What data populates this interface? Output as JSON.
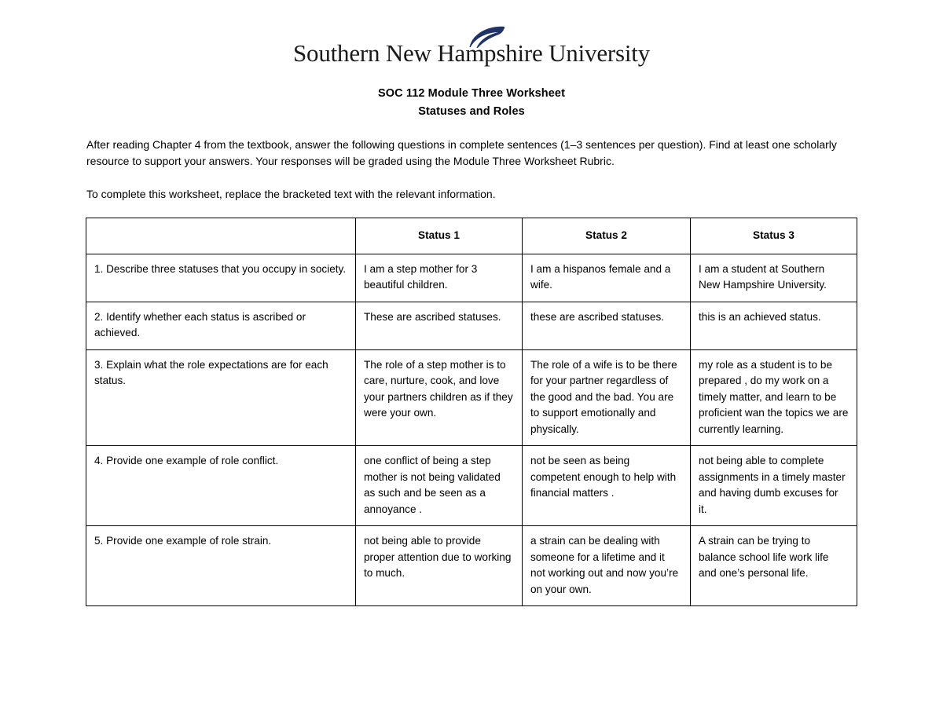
{
  "logo": {
    "text": "Southern New Hampshire University",
    "quill_color": "#1F3366",
    "icon": "feather-quill-icon"
  },
  "header": {
    "title": "SOC 112 Module Three Worksheet",
    "subtitle": "Statuses and Roles"
  },
  "intro": {
    "paragraph_1": "After reading Chapter 4 from the textbook, answer the following questions in complete sentences (1–3 sentences per question). Find at least one scholarly resource to support your answers. Your responses will be graded using the Module Three Worksheet Rubric.",
    "paragraph_2": "To complete this worksheet, replace the bracketed text with the relevant information."
  },
  "table": {
    "headers": [
      "",
      "Status 1",
      "Status 2",
      "Status 3"
    ],
    "rows": [
      {
        "question": "1. Describe three statuses that you occupy in society.",
        "status_1": "I am a step mother for 3 beautiful children.",
        "status_2": "I am a hispanos female and a wife.",
        "status_3": "I am a student at Southern New Hampshire University."
      },
      {
        "question": "2. Identify whether each status is ascribed or achieved.",
        "status_1": "These are ascribed statuses.",
        "status_2": "these are ascribed statuses.",
        "status_3": "this is an achieved status."
      },
      {
        "question": "3. Explain what the role expectations are for each status.",
        "status_1": "The role of a step mother is to care, nurture, cook, and love your partners children as if they were your own.",
        "status_2": "The role of a wife is to be there for your partner regardless of the good and the bad. You are to support emotionally and physically.",
        "status_3": "my role as a student is to be prepared , do my work on a timely matter, and learn to be proficient wan the topics we are currently learning."
      },
      {
        "question": "4. Provide one example of role conflict.",
        "status_1": "one conflict of being a step mother is not being validated as such and be seen as a annoyance .",
        "status_2": "not be seen as being competent enough to help with financial matters .",
        "status_3": "not being able to complete assignments in a timely master and having dumb excuses for it."
      },
      {
        "question": "5. Provide one example of role strain.",
        "status_1": "not being able to provide proper attention due to working to much.",
        "status_2": "a strain can be dealing with someone for a lifetime and it not working out and now you’re on your own.",
        "status_3": "A strain can be trying to balance school life work life and one’s personal life."
      }
    ]
  }
}
